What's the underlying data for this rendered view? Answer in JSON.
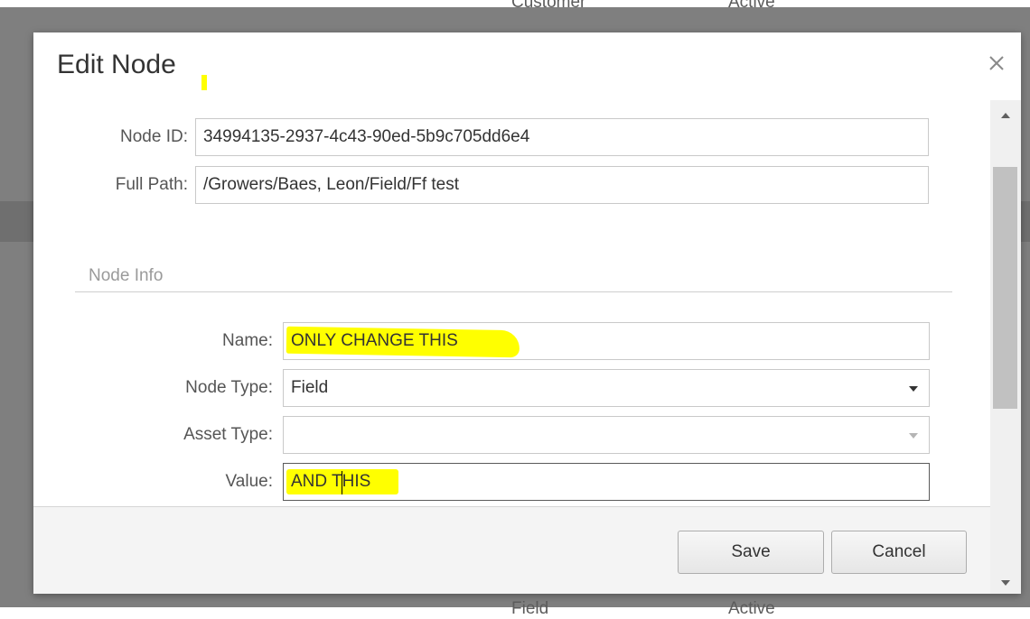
{
  "background": {
    "column_headers_top": [
      "Customer",
      "Active"
    ],
    "column_headers_bottom": [
      "Field",
      "Active"
    ]
  },
  "dialog": {
    "title": "Edit Node",
    "close_symbol": "×",
    "fields": {
      "node_id": {
        "label": "Node ID:",
        "value": "34994135-2937-4c43-90ed-5b9c705dd6e4"
      },
      "full_path": {
        "label": "Full Path:",
        "value": "/Growers/Baes, Leon/Field/Ff test"
      }
    },
    "section": {
      "title": "Node Info",
      "name": {
        "label": "Name:",
        "value": "ONLY CHANGE THIS"
      },
      "node_type": {
        "label": "Node Type:",
        "value": "Field",
        "icon": "chevron-down-icon"
      },
      "asset_type": {
        "label": "Asset Type:",
        "value": "",
        "icon": "chevron-down-icon"
      },
      "value": {
        "label": "Value:",
        "value": "AND THIS"
      }
    },
    "footer": {
      "save_label": "Save",
      "cancel_label": "Cancel"
    }
  },
  "colors": {
    "highlight": "#ffff00",
    "overlay": "#7f7f7f",
    "button_border": "#adadad"
  }
}
